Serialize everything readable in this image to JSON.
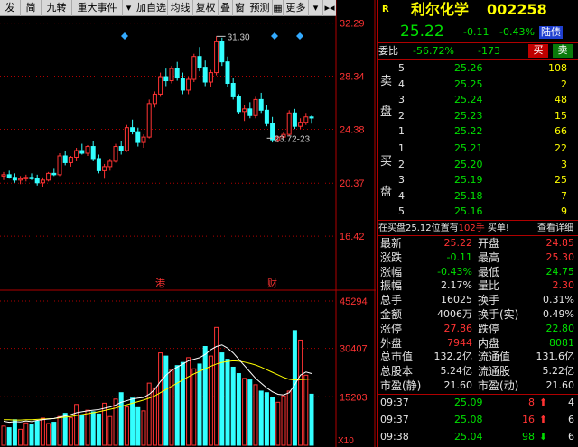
{
  "toolbar": {
    "items": [
      "发",
      "简",
      "九转",
      "重大事件",
      "加自选",
      "均线",
      "复权",
      "叠",
      "窗",
      "预测",
      "更多"
    ],
    "dropdown_arrow": "▾",
    "nav_icon": "▸◂"
  },
  "chart_data": [
    {
      "type": "candlestick",
      "title": "",
      "y_axis_ticks": [
        "32.29",
        "28.34",
        "24.38",
        "20.37",
        "16.42"
      ],
      "ylim": [
        12.4,
        32.8
      ],
      "candles": [
        [
          20.9,
          21.2,
          20.6,
          21.0
        ],
        [
          21.0,
          21.3,
          20.7,
          20.8
        ],
        [
          20.8,
          21.1,
          20.4,
          20.6
        ],
        [
          20.6,
          20.9,
          20.3,
          20.7
        ],
        [
          20.7,
          21.0,
          20.5,
          20.8
        ],
        [
          20.8,
          21.1,
          20.6,
          20.7
        ],
        [
          20.7,
          21.0,
          20.2,
          20.4
        ],
        [
          20.4,
          20.8,
          20.1,
          20.6
        ],
        [
          20.6,
          21.2,
          20.5,
          21.1
        ],
        [
          21.1,
          21.5,
          20.9,
          21.0
        ],
        [
          21.0,
          22.6,
          20.9,
          22.4
        ],
        [
          22.4,
          22.8,
          21.7,
          21.9
        ],
        [
          21.9,
          22.4,
          21.6,
          22.3
        ],
        [
          22.3,
          23.0,
          22.0,
          22.8
        ],
        [
          22.8,
          23.3,
          22.5,
          22.6
        ],
        [
          22.6,
          23.2,
          22.4,
          23.1
        ],
        [
          23.1,
          23.5,
          22.0,
          22.2
        ],
        [
          22.2,
          22.5,
          21.1,
          21.3
        ],
        [
          21.3,
          21.8,
          20.7,
          21.6
        ],
        [
          21.6,
          22.2,
          21.3,
          22.0
        ],
        [
          22.0,
          23.3,
          21.9,
          23.1
        ],
        [
          23.1,
          23.5,
          22.5,
          22.8
        ],
        [
          22.8,
          24.7,
          22.7,
          24.5
        ],
        [
          24.5,
          25.1,
          24.0,
          24.2
        ],
        [
          24.2,
          24.5,
          23.1,
          23.4
        ],
        [
          23.4,
          24.0,
          23.0,
          23.8
        ],
        [
          23.8,
          26.6,
          23.7,
          26.3
        ],
        [
          26.3,
          27.2,
          26.0,
          27.0
        ],
        [
          27.0,
          28.6,
          26.8,
          28.3
        ],
        [
          28.3,
          28.9,
          27.6,
          28.0
        ],
        [
          28.0,
          29.1,
          27.8,
          28.9
        ],
        [
          28.9,
          29.4,
          28.0,
          28.2
        ],
        [
          28.2,
          28.6,
          27.0,
          27.3
        ],
        [
          27.3,
          28.3,
          27.0,
          28.1
        ],
        [
          28.1,
          30.0,
          27.9,
          29.8
        ],
        [
          29.8,
          30.5,
          28.7,
          29.0
        ],
        [
          29.0,
          29.5,
          27.6,
          27.9
        ],
        [
          27.9,
          28.8,
          27.5,
          28.6
        ],
        [
          28.6,
          31.3,
          28.4,
          30.9
        ],
        [
          30.9,
          31.2,
          29.1,
          29.4
        ],
        [
          29.4,
          29.8,
          27.5,
          27.8
        ],
        [
          27.8,
          28.2,
          26.6,
          26.8
        ],
        [
          26.8,
          27.0,
          25.5,
          25.7
        ],
        [
          25.7,
          26.2,
          25.0,
          25.9
        ],
        [
          25.9,
          26.4,
          25.2,
          25.4
        ],
        [
          25.4,
          26.8,
          25.2,
          26.6
        ],
        [
          26.6,
          27.1,
          25.6,
          25.8
        ],
        [
          25.8,
          26.2,
          24.6,
          24.8
        ],
        [
          24.8,
          25.3,
          23.4,
          23.6
        ],
        [
          23.6,
          23.9,
          23.4,
          23.8
        ],
        [
          23.8,
          24.2,
          23.7,
          24.0
        ],
        [
          24.0,
          25.8,
          23.9,
          25.6
        ],
        [
          25.6,
          25.9,
          24.4,
          24.6
        ],
        [
          24.6,
          25.2,
          24.4,
          24.9
        ],
        [
          24.9,
          25.6,
          24.7,
          25.3
        ],
        [
          25.3,
          25.4,
          24.8,
          25.22
        ]
      ],
      "high_label": "31.30",
      "low_label": "23.72-23",
      "markers": [
        "港",
        "财"
      ]
    },
    {
      "type": "bar",
      "y_axis_ticks": [
        "45294",
        "30407",
        "15203"
      ],
      "unit_label": "X10",
      "values": [
        6000,
        5500,
        8000,
        5000,
        7000,
        6500,
        7500,
        8500,
        6800,
        7200,
        9000,
        10000,
        8600,
        12800,
        9500,
        11000,
        10500,
        9800,
        13200,
        9000,
        14500,
        16500,
        12000,
        14800,
        11800,
        10800,
        19500,
        18000,
        29000,
        28000,
        23800,
        25000,
        26000,
        27500,
        24000,
        25500,
        31000,
        28000,
        37000,
        29000,
        27000,
        24500,
        22500,
        21000,
        20500,
        19000,
        17000,
        16500,
        15000,
        13500,
        15500,
        17000,
        36000,
        33000,
        22000,
        16025
      ],
      "ma_fast": [
        7500,
        7200,
        7400,
        7300,
        7600,
        7400,
        7800,
        8000,
        8200,
        8400,
        8800,
        9200,
        9600,
        10200,
        10500,
        10800,
        11000,
        11200,
        11600,
        12000,
        12600,
        13500,
        14000,
        14500,
        14800,
        15000,
        16000,
        17500,
        20000,
        22000,
        23500,
        24500,
        25500,
        26500,
        27000,
        27500,
        28500,
        30000,
        31000,
        31500,
        30500,
        29000,
        27000,
        25000,
        23000,
        21000,
        19500,
        18000,
        16800,
        16000,
        15800,
        16500,
        19000,
        22000,
        23000,
        22500
      ],
      "ma_slow": [
        8000,
        8000,
        7900,
        7900,
        8000,
        8000,
        8100,
        8200,
        8300,
        8400,
        8600,
        8800,
        9000,
        9300,
        9600,
        9900,
        10200,
        10500,
        10900,
        11300,
        11700,
        12200,
        12700,
        13200,
        13700,
        14200,
        14800,
        15500,
        16500,
        17500,
        18500,
        19500,
        20500,
        21500,
        22400,
        23200,
        24000,
        24800,
        25500,
        26000,
        26300,
        26500,
        26400,
        26100,
        25700,
        25200,
        24500,
        23700,
        22900,
        22100,
        21300,
        20700,
        20500,
        20600,
        20700,
        20800
      ]
    }
  ],
  "quote": {
    "flag": "R",
    "name": "利尔化学",
    "code": "002258",
    "price": "25.22",
    "change": "-0.11",
    "change_pct": "-0.43%",
    "tag": "陆债"
  },
  "weibi": {
    "label": "委比",
    "pct": "-56.72%",
    "diff": "-173",
    "sell": "买",
    "buy": "卖"
  },
  "sell_orders": [
    {
      "lv": "5",
      "price": "25.26",
      "vol": "108"
    },
    {
      "lv": "4",
      "price": "25.25",
      "vol": "2"
    },
    {
      "lv": "3",
      "price": "25.24",
      "vol": "48"
    },
    {
      "lv": "2",
      "price": "25.23",
      "vol": "15"
    },
    {
      "lv": "1",
      "price": "25.22",
      "vol": "66"
    }
  ],
  "buy_orders": [
    {
      "lv": "1",
      "price": "25.21",
      "vol": "22"
    },
    {
      "lv": "2",
      "price": "25.20",
      "vol": "3"
    },
    {
      "lv": "3",
      "price": "25.19",
      "vol": "25"
    },
    {
      "lv": "4",
      "price": "25.18",
      "vol": "7"
    },
    {
      "lv": "5",
      "price": "25.16",
      "vol": "9"
    }
  ],
  "sell_label": [
    "卖",
    "盘"
  ],
  "buy_label": [
    "买",
    "盘"
  ],
  "info": {
    "left": "在买盘",
    "price": "25.12",
    "mid": "位置有",
    "qty": "102手",
    "act": "买单!",
    "link": "查看详细"
  },
  "stats": [
    {
      "l1": "最新",
      "v1": "25.22",
      "c1": "r",
      "l2": "开盘",
      "v2": "24.85",
      "c2": "r"
    },
    {
      "l1": "涨跌",
      "v1": "-0.11",
      "c1": "g",
      "l2": "最高",
      "v2": "25.30",
      "c2": "r"
    },
    {
      "l1": "涨幅",
      "v1": "-0.43%",
      "c1": "g",
      "l2": "最低",
      "v2": "24.75",
      "c2": "g"
    },
    {
      "l1": "振幅",
      "v1": "2.17%",
      "c1": "w",
      "l2": "量比",
      "v2": "2.30",
      "c2": "r"
    },
    {
      "l1": "总手",
      "v1": "16025",
      "c1": "w",
      "l2": "换手",
      "v2": "0.31%",
      "c2": "w"
    },
    {
      "l1": "金额",
      "v1": "4006万",
      "c1": "w",
      "l2": "换手(实)",
      "v2": "0.49%",
      "c2": "w"
    },
    {
      "l1": "涨停",
      "v1": "27.86",
      "c1": "r",
      "l2": "跌停",
      "v2": "22.80",
      "c2": "g"
    },
    {
      "l1": "外盘",
      "v1": "7944",
      "c1": "r",
      "l2": "内盘",
      "v2": "8081",
      "c2": "g"
    },
    {
      "l1": "总市值",
      "v1": "132.2亿",
      "c1": "w",
      "l2": "流通值",
      "v2": "131.6亿",
      "c2": "w"
    },
    {
      "l1": "总股本",
      "v1": "5.24亿",
      "c1": "w",
      "l2": "流通股",
      "v2": "5.22亿",
      "c2": "w"
    },
    {
      "l1": "市盈(静)",
      "v1": "21.60",
      "c1": "w",
      "l2": "市盈(动)",
      "v2": "21.60",
      "c2": "w"
    }
  ],
  "ticks": [
    {
      "time": "09:37",
      "price": "25.09",
      "vol": "8",
      "dir": "up",
      "cnt": "4"
    },
    {
      "time": "09:37",
      "price": "25.08",
      "vol": "16",
      "dir": "up",
      "cnt": "6"
    },
    {
      "time": "09:38",
      "price": "25.04",
      "vol": "98",
      "dir": "down",
      "cnt": "6"
    }
  ],
  "colors": {
    "up": "#ff3333",
    "down": "#33ffff",
    "grid": "#b00000",
    "ma_fast": "#ffffff",
    "ma_slow": "#ffff00"
  }
}
